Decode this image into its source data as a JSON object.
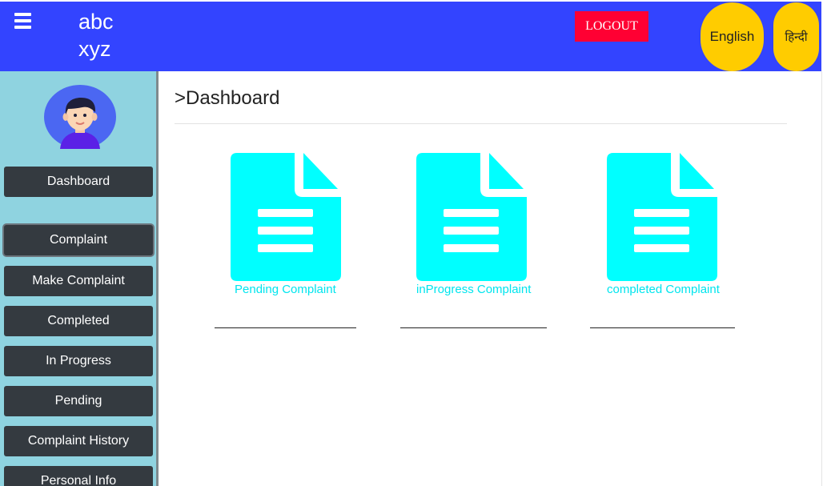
{
  "header": {
    "brand_line1": "abc",
    "brand_line2": "xyz",
    "logout_label": "LOGOUT",
    "lang_english": "English",
    "lang_hindi": "हिन्दी",
    "colors": {
      "bar": "#3344ff",
      "logout": "#ff0033",
      "lang": "#ffcc00"
    }
  },
  "sidebar": {
    "avatar_icon": "user-avatar-icon",
    "items": [
      {
        "label": "Dashboard"
      },
      {
        "label": "Complaint"
      },
      {
        "label": "Make Complaint"
      },
      {
        "label": "Completed"
      },
      {
        "label": "In Progress"
      },
      {
        "label": "Pending"
      },
      {
        "label": "Complaint History"
      },
      {
        "label": "Personal Info"
      }
    ]
  },
  "main": {
    "title": ">Dashboard",
    "cards": [
      {
        "label": "Pending Complaint",
        "icon": "document-icon"
      },
      {
        "label": "inProgress Complaint",
        "icon": "document-icon"
      },
      {
        "label": "completed Complaint",
        "icon": "document-icon"
      }
    ],
    "accent_color": "#00ffff"
  }
}
